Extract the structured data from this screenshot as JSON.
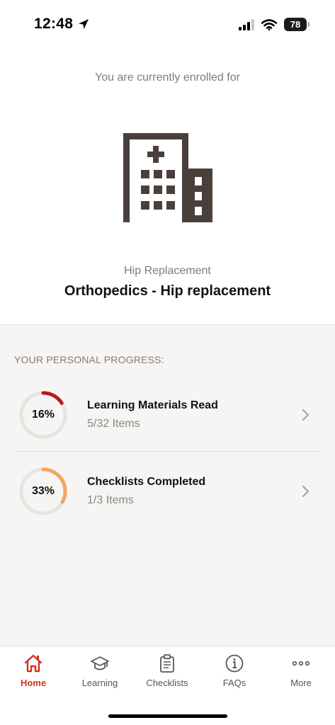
{
  "status_bar": {
    "time": "12:48",
    "battery": "78"
  },
  "enrollment": {
    "label": "You are currently enrolled for",
    "program_category": "Hip Replacement",
    "program_name": "Orthopedics - Hip replacement",
    "icon": "hospital-building-icon"
  },
  "progress": {
    "heading": "YOUR PERSONAL PROGRESS:",
    "items": [
      {
        "title": "Learning Materials Read",
        "detail": "5/32 Items",
        "percent_label": "16%",
        "fraction": 0.16,
        "color": "#b01c1c"
      },
      {
        "title": "Checklists Completed",
        "detail": "1/3 Items",
        "percent_label": "33%",
        "fraction": 0.33,
        "color": "#f6a35c"
      }
    ]
  },
  "tabbar": {
    "active_color": "#d6301d",
    "tabs": [
      {
        "label": "Home",
        "icon": "home-icon",
        "active": true
      },
      {
        "label": "Learning",
        "icon": "graduation-cap-icon"
      },
      {
        "label": "Checklists",
        "icon": "clipboard-icon"
      },
      {
        "label": "FAQs",
        "icon": "info-icon"
      },
      {
        "label": "More",
        "icon": "more-dots-icon"
      }
    ]
  }
}
